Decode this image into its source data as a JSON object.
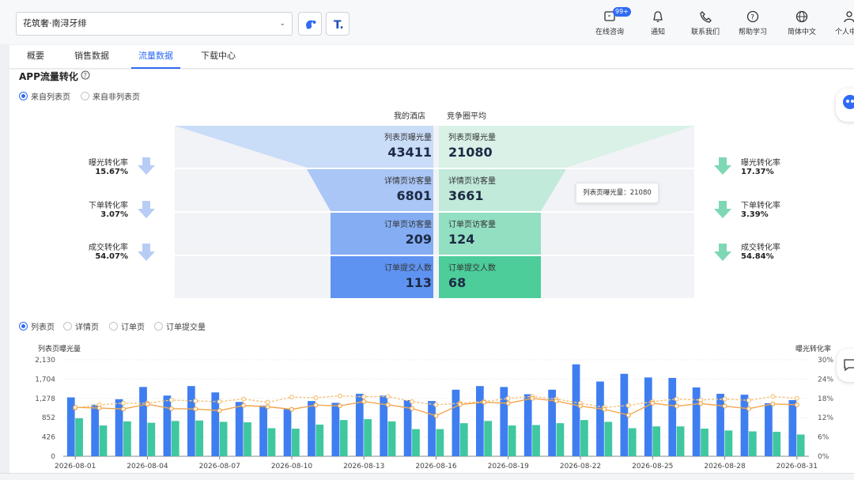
{
  "header": {
    "hotel_select_value": "花筑奢·南浔牙绯",
    "toolbar": [
      {
        "label": "在线咨询",
        "icon": "chat-icon",
        "badge": "99+"
      },
      {
        "label": "通知",
        "icon": "bell-icon"
      },
      {
        "label": "联系我们",
        "icon": "phone-icon"
      },
      {
        "label": "帮助学习",
        "icon": "help-icon"
      },
      {
        "label": "简体中文",
        "icon": "globe-icon"
      },
      {
        "label": "个人中心",
        "icon": "user-icon"
      }
    ]
  },
  "tabs": [
    "概要",
    "销售数据",
    "流量数据",
    "下载中心"
  ],
  "active_tab": "流量数据",
  "section": {
    "title": "APP流量转化"
  },
  "source_radios": [
    {
      "label": "来自列表页",
      "checked": true
    },
    {
      "label": "来自非列表页",
      "checked": false
    }
  ],
  "funnel": {
    "my_hotel_label": "我的酒店",
    "competitor_label": "竞争圈平均",
    "rows": [
      {
        "label": "列表页曝光量",
        "mine": "43411",
        "comp": "21080"
      },
      {
        "label": "详情页访客量",
        "mine": "6801",
        "comp": "3661"
      },
      {
        "label": "订单页访客量",
        "mine": "209",
        "comp": "124"
      },
      {
        "label": "订单提交人数",
        "mine": "113",
        "comp": "68"
      }
    ],
    "left_rates": [
      {
        "label": "曝光转化率",
        "value": "15.67%"
      },
      {
        "label": "下单转化率",
        "value": "3.07%"
      },
      {
        "label": "成交转化率",
        "value": "54.07%"
      }
    ],
    "right_rates": [
      {
        "label": "曝光转化率",
        "value": "17.37%"
      },
      {
        "label": "下单转化率",
        "value": "3.39%"
      },
      {
        "label": "成交转化率",
        "value": "54.84%"
      }
    ],
    "tooltip": "列表页曝光量：21080",
    "colors": {
      "mine": [
        "#c9dcf8",
        "#a9c6f6",
        "#84adf4",
        "#5f93f2"
      ],
      "comp": [
        "#d9f1e7",
        "#c1eadb",
        "#92dfc2",
        "#4ccd9a"
      ]
    }
  },
  "metric_radios": [
    {
      "label": "列表页",
      "checked": true
    },
    {
      "label": "详情页",
      "checked": false
    },
    {
      "label": "订单页",
      "checked": false
    },
    {
      "label": "订单提交量",
      "checked": false
    }
  ],
  "chart_data": {
    "type": "bar",
    "ylabel": "列表页曝光量",
    "y2label": "曝光转化率",
    "ylim": [
      0,
      2130
    ],
    "y_ticks": [
      "0",
      "426",
      "852",
      "1,278",
      "1,704",
      "2,130"
    ],
    "y2lim": [
      0,
      30
    ],
    "y2_ticks": [
      "0%",
      "6%",
      "12%",
      "18%",
      "24%",
      "30%"
    ],
    "x_tick_labels": [
      "2026-08-01",
      "2026-08-04",
      "2026-08-07",
      "2026-08-10",
      "2026-08-13",
      "2026-08-16",
      "2026-08-19",
      "2026-08-22",
      "2026-08-25",
      "2026-08-28",
      "2026-08-31"
    ],
    "categories": [
      "2026-08-01",
      "2026-08-02",
      "2026-08-03",
      "2026-08-04",
      "2026-08-05",
      "2026-08-06",
      "2026-08-07",
      "2026-08-08",
      "2026-08-09",
      "2026-08-10",
      "2026-08-11",
      "2026-08-12",
      "2026-08-13",
      "2026-08-14",
      "2026-08-15",
      "2026-08-16",
      "2026-08-17",
      "2026-08-18",
      "2026-08-19",
      "2026-08-20",
      "2026-08-21",
      "2026-08-22",
      "2026-08-23",
      "2026-08-24",
      "2026-08-25",
      "2026-08-26",
      "2026-08-27",
      "2026-08-28",
      "2026-08-29",
      "2026-08-30",
      "2026-08-31"
    ],
    "bar_series": [
      {
        "color": "#3f7ef0",
        "values": [
          1300,
          1140,
          1260,
          1530,
          1340,
          1550,
          1410,
          1200,
          1120,
          1050,
          1220,
          1180,
          1380,
          1340,
          1240,
          1220,
          1470,
          1550,
          1530,
          1370,
          1470,
          2030,
          1650,
          1820,
          1740,
          1730,
          1520,
          1380,
          1360,
          1170,
          1240
        ]
      },
      {
        "color": "#3fc7a0",
        "values": [
          840,
          680,
          770,
          740,
          780,
          790,
          760,
          750,
          620,
          610,
          700,
          800,
          820,
          770,
          600,
          600,
          730,
          780,
          680,
          690,
          730,
          800,
          760,
          620,
          660,
          660,
          610,
          570,
          550,
          540,
          480
        ]
      }
    ],
    "line_series": [
      {
        "color": "#f6c37a",
        "dashed": true,
        "values": [
          15.0,
          16.0,
          16.5,
          16.5,
          17.5,
          17.2,
          17.0,
          17.8,
          16.8,
          18.4,
          18.2,
          18.8,
          18.5,
          18.6,
          17.0,
          16.0,
          16.5,
          17.0,
          18.0,
          18.6,
          17.8,
          16.5,
          15.2,
          15.8,
          17.0,
          17.8,
          17.5,
          17.8,
          17.4,
          18.6,
          18.0
        ]
      },
      {
        "color": "#f2a64b",
        "dashed": false,
        "values": [
          15.2,
          15.0,
          14.7,
          16.2,
          14.8,
          14.7,
          14.2,
          15.8,
          15.4,
          14.6,
          15.9,
          15.7,
          17.0,
          16.0,
          14.9,
          12.6,
          16.1,
          16.8,
          16.5,
          18.0,
          17.2,
          15.6,
          14.6,
          12.8,
          16.5,
          15.6,
          16.4,
          15.6,
          14.8,
          16.3,
          16.0
        ]
      }
    ]
  }
}
